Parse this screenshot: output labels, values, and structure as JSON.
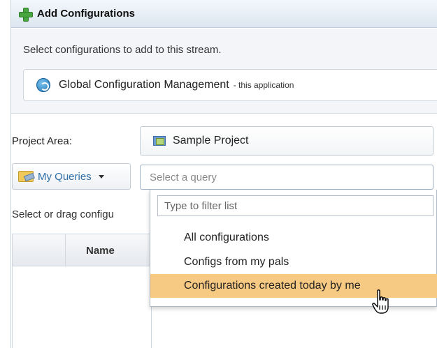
{
  "dialog": {
    "title": "Add Configurations",
    "instruction": "Select configurations to add to this stream.",
    "application": {
      "name": "Global Configuration Management",
      "note": "- this application"
    }
  },
  "project_area": {
    "label": "Project Area:",
    "value": "Sample Project"
  },
  "queries": {
    "button_label": "My Queries",
    "select_placeholder": "Select a query",
    "filter_placeholder": "Type to filter list",
    "options": [
      "All configurations",
      "Configs from my pals",
      "Configurations created today by me"
    ],
    "highlighted_option": "Configurations created today by me"
  },
  "results": {
    "drag_label": "Select or drag configu",
    "columns": [
      "Name"
    ]
  },
  "colors": {
    "highlight": "#f7ca83",
    "link": "#2f6fa8",
    "title_bar": "#dce6f0"
  },
  "icons": [
    "plus-icon",
    "gcm-app-icon",
    "project-icon",
    "folder-query-icon",
    "caret-down-icon",
    "hand-cursor-icon"
  ]
}
